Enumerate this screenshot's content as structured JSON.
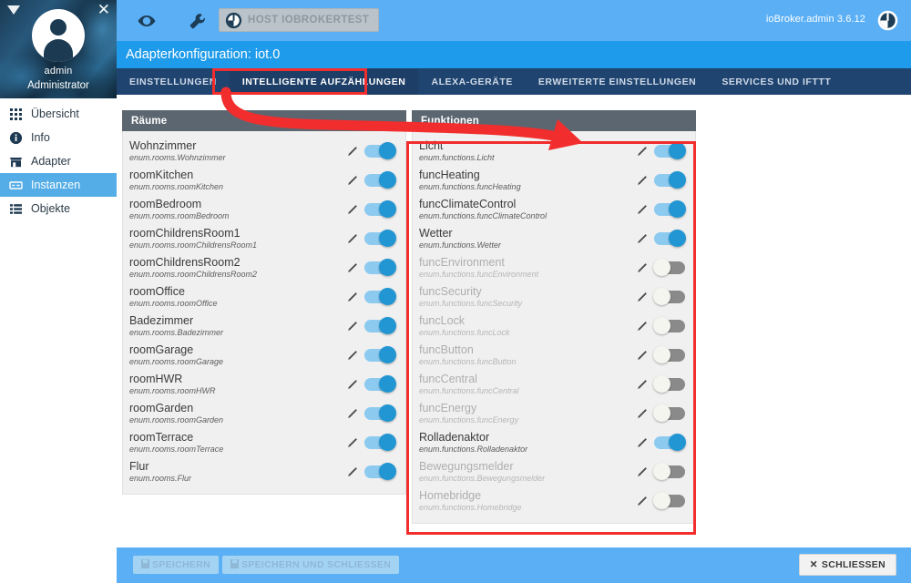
{
  "sidebar": {
    "user": "admin",
    "role": "Administrator",
    "caret_icon": "caret-down-icon",
    "close_icon": "close-icon",
    "avatar_icon": "user-avatar-icon",
    "items": [
      {
        "label": "Übersicht",
        "icon": "grid-icon",
        "active": false
      },
      {
        "label": "Info",
        "icon": "info-icon",
        "active": false
      },
      {
        "label": "Adapter",
        "icon": "store-icon",
        "active": false
      },
      {
        "label": "Instanzen",
        "icon": "instances-icon",
        "active": true
      },
      {
        "label": "Objekte",
        "icon": "list-icon",
        "active": false
      }
    ]
  },
  "topbar": {
    "eye_icon": "eye-icon",
    "wrench_icon": "wrench-icon",
    "host_button": "HOST IOBROKERTEST",
    "host_icon": "power-icon",
    "version": "ioBroker.admin 3.6.12",
    "power_icon": "power-icon"
  },
  "config": {
    "title": "Adapterkonfiguration: iot.0",
    "tabs": [
      {
        "label": "EINSTELLUNGEN",
        "active": false
      },
      {
        "label": "INTELLIGENTE AUFZÄHLUNGEN",
        "active": true
      },
      {
        "label": "ALEXA-GERÄTE",
        "active": false
      },
      {
        "label": "ERWEITERTE EINSTELLUNGEN",
        "active": false
      },
      {
        "label": "SERVICES UND IFTTT",
        "active": false
      }
    ]
  },
  "rooms_panel": {
    "title": "Räume",
    "edit_icon": "pencil-icon",
    "rows": [
      {
        "name": "Wohnzimmer",
        "path": "enum.rooms.Wohnzimmer",
        "enabled": true
      },
      {
        "name": "roomKitchen",
        "path": "enum.rooms.roomKitchen",
        "enabled": true
      },
      {
        "name": "roomBedroom",
        "path": "enum.rooms.roomBedroom",
        "enabled": true
      },
      {
        "name": "roomChildrensRoom1",
        "path": "enum.rooms.roomChildrensRoom1",
        "enabled": true
      },
      {
        "name": "roomChildrensRoom2",
        "path": "enum.rooms.roomChildrensRoom2",
        "enabled": true
      },
      {
        "name": "roomOffice",
        "path": "enum.rooms.roomOffice",
        "enabled": true
      },
      {
        "name": "Badezimmer",
        "path": "enum.rooms.Badezimmer",
        "enabled": true
      },
      {
        "name": "roomGarage",
        "path": "enum.rooms.roomGarage",
        "enabled": true
      },
      {
        "name": "roomHWR",
        "path": "enum.rooms.roomHWR",
        "enabled": true
      },
      {
        "name": "roomGarden",
        "path": "enum.rooms.roomGarden",
        "enabled": true
      },
      {
        "name": "roomTerrace",
        "path": "enum.rooms.roomTerrace",
        "enabled": true
      },
      {
        "name": "Flur",
        "path": "enum.rooms.Flur",
        "enabled": true
      }
    ]
  },
  "functions_panel": {
    "title": "Funktionen",
    "edit_icon": "pencil-icon",
    "rows": [
      {
        "name": "Licht",
        "path": "enum.functions.Licht",
        "enabled": true
      },
      {
        "name": "funcHeating",
        "path": "enum.functions.funcHeating",
        "enabled": true
      },
      {
        "name": "funcClimateControl",
        "path": "enum.functions.funcClimateControl",
        "enabled": true
      },
      {
        "name": "Wetter",
        "path": "enum.functions.Wetter",
        "enabled": true
      },
      {
        "name": "funcEnvironment",
        "path": "enum.functions.funcEnvironment",
        "enabled": false
      },
      {
        "name": "funcSecurity",
        "path": "enum.functions.funcSecurity",
        "enabled": false
      },
      {
        "name": "funcLock",
        "path": "enum.functions.funcLock",
        "enabled": false
      },
      {
        "name": "funcButton",
        "path": "enum.functions.funcButton",
        "enabled": false
      },
      {
        "name": "funcCentral",
        "path": "enum.functions.funcCentral",
        "enabled": false
      },
      {
        "name": "funcEnergy",
        "path": "enum.functions.funcEnergy",
        "enabled": false
      },
      {
        "name": "Rolladenaktor",
        "path": "enum.functions.Rolladenaktor",
        "enabled": true
      },
      {
        "name": "Bewegungsmelder",
        "path": "enum.functions.Bewegungsmelder",
        "enabled": false
      },
      {
        "name": "Homebridge",
        "path": "enum.functions.Homebridge",
        "enabled": false
      }
    ]
  },
  "footer": {
    "save": "SPEICHERN",
    "save_close": "SPEICHERN UND SCHLIESSEN",
    "close": "SCHLIESSEN",
    "save_icon": "save-icon",
    "close_icon": "close-icon"
  },
  "annotations": {
    "accent_color": "#f22d2d",
    "tab_highlight": "INTELLIGENTE AUFZÄHLUNGEN",
    "panel_highlight": "Funktionen"
  }
}
